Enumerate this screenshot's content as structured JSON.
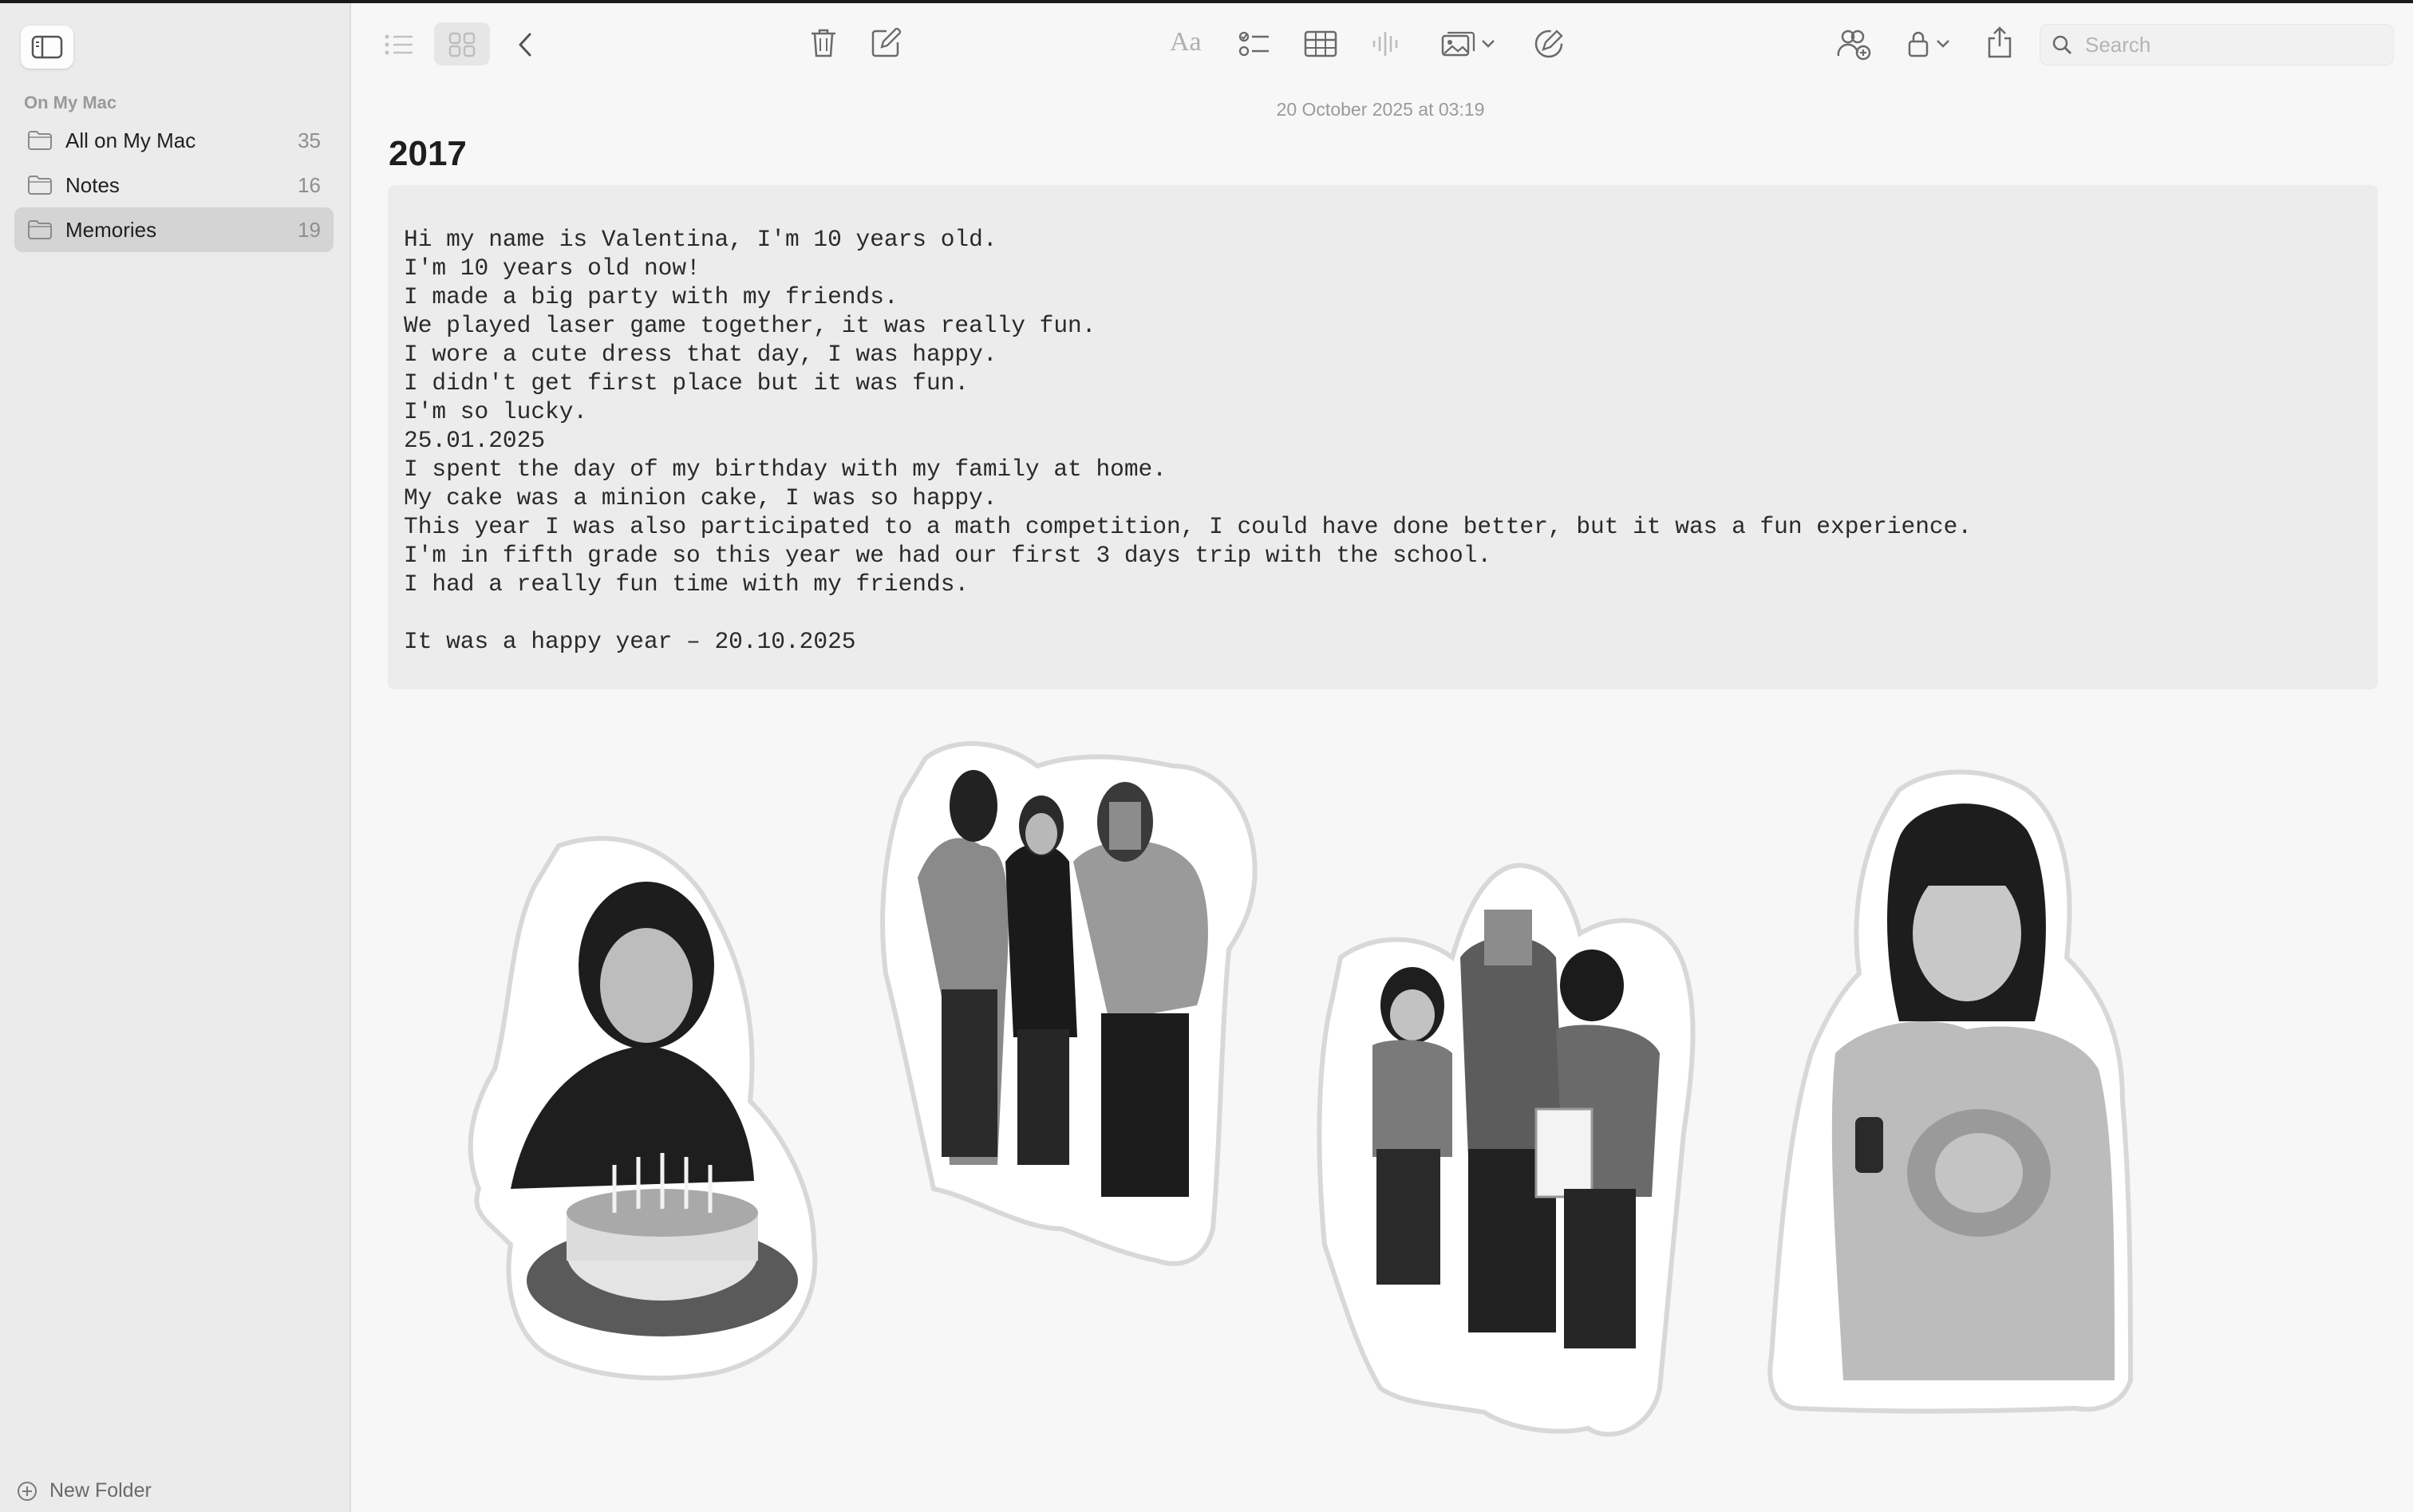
{
  "sidebar": {
    "section_label": "On My Mac",
    "folders": [
      {
        "name": "All on My Mac",
        "count": "35",
        "selected": false
      },
      {
        "name": "Notes",
        "count": "16",
        "selected": false
      },
      {
        "name": "Memories",
        "count": "19",
        "selected": true
      }
    ],
    "new_folder_label": "New Folder"
  },
  "toolbar": {
    "format_label": "Aa",
    "search_placeholder": "Search"
  },
  "note": {
    "timestamp": "20 October 2025 at 03:19",
    "title": "2017",
    "body_lines": [
      "Hi my name is Valentina, I'm 10 years old.",
      "I'm 10 years old now!",
      "I made a big party with my friends.",
      "We played laser game together, it was really fun.",
      "I wore a cute dress that day, I was happy.",
      "I didn't get first place but it was fun.",
      "I'm so lucky.",
      "25.01.2025",
      "I spent the day of my birthday with my family at home.",
      "My cake was a minion cake, I was so happy.",
      "This year I was also participated to a math competition, I could have done better, but it was a fun experience.",
      "I'm in fifth grade so this year we had our first 3 days trip with the school.",
      "I had a really fun time with my friends.",
      "",
      "It was a happy year – 20.10.2025"
    ]
  },
  "colors": {
    "sidebar_bg": "#ebebeb",
    "selected_folder_bg": "#d4d4d4",
    "note_bg": "#f7f7f7",
    "code_block_bg": "#ececec"
  },
  "photos": [
    {
      "subject": "girl with birthday cake sticker"
    },
    {
      "subject": "three friends group sticker"
    },
    {
      "subject": "three girls with certificate sticker"
    },
    {
      "subject": "smiling girl portrait sticker"
    }
  ]
}
